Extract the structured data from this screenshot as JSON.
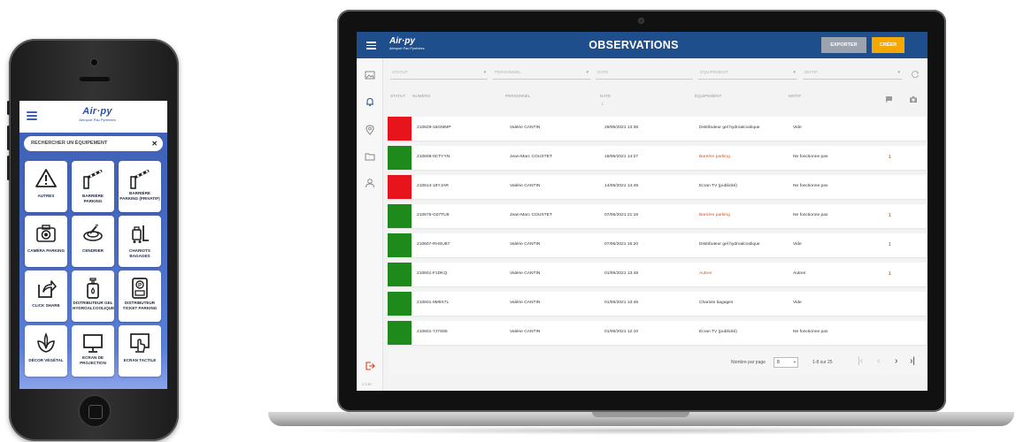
{
  "phone": {
    "logo_text": "Air·py",
    "logo_sub": "Aéroport Pau Pyrénées",
    "search_placeholder": "RECHERCHER UN ÉQUIPEMENT",
    "search_clear": "✕",
    "tiles": [
      {
        "label": "AUTRES",
        "icon": "warning-icon"
      },
      {
        "label": "BARRIÈRE PARKING",
        "icon": "barrier-icon"
      },
      {
        "label": "BARRIÈRE PARKING (PRIVATIF)",
        "icon": "barrier-private-icon"
      },
      {
        "label": "CAMÉRA PARKING",
        "icon": "camera-icon"
      },
      {
        "label": "CENDRIER",
        "icon": "ashtray-icon"
      },
      {
        "label": "CHARIOTS BAGAGES",
        "icon": "luggage-cart-icon"
      },
      {
        "label": "CLICK SHARE",
        "icon": "share-icon"
      },
      {
        "label": "DISTRIBUTEUR GEL HYDROALCOOLIQUE",
        "icon": "gel-dispenser-icon"
      },
      {
        "label": "DISTRIBUTEUR TICKET PARKING",
        "icon": "ticket-machine-icon"
      },
      {
        "label": "DÉCOR VÉGÉTAL",
        "icon": "plant-icon"
      },
      {
        "label": "ECRAN DE PROJECTION",
        "icon": "monitor-icon"
      },
      {
        "label": "ECRAN TACTILE",
        "icon": "touchscreen-icon"
      }
    ]
  },
  "app": {
    "logo_text": "Air·py",
    "logo_sub": "Aéroport Pau Pyrénées",
    "title": "OBSERVATIONS",
    "export_label": "EXPORTER",
    "create_label": "CRÉER",
    "version": "2.2.87",
    "nav_icons": [
      "image-icon",
      "bell-icon",
      "location-icon",
      "folder-icon",
      "user-icon"
    ],
    "logout_icon": "logout-icon",
    "filters": [
      "STATUT",
      "PERSONNEL",
      "DATE",
      "ÉQUIPEMENT",
      "MOTIF"
    ],
    "columns": [
      "STATUT",
      "NUMÉRO",
      "PERSONNEL",
      "DATE",
      "ÉQUIPEMENT",
      "MOTIF"
    ],
    "sort_arrow": "↓",
    "colors": {
      "red": "#e8141b",
      "green": "#1e8a1b",
      "header": "#1f4e8c",
      "accent": "#f5a800"
    },
    "rows": [
      {
        "status": "red",
        "numero": "210629-15GMMP",
        "personnel": "Valérie CANTIN",
        "date": "29/06/2021 13:38",
        "equipement": "Distributeur gel hydroalcoolique",
        "eq_orange": false,
        "motif": "Vide",
        "count": ""
      },
      {
        "status": "green",
        "numero": "210608-0CTYYN",
        "personnel": "Jean-Marc COUSTET",
        "date": "18/06/2021 14:27",
        "equipement": "Barrière parking",
        "eq_orange": true,
        "motif": "Ne fonctionne pas",
        "count": "1"
      },
      {
        "status": "red",
        "numero": "210614-18YJAR",
        "personnel": "Valérie CANTIN",
        "date": "14/06/2021 14:49",
        "equipement": "Ecran TV (publicité)",
        "eq_orange": false,
        "motif": "Ne fonctionne pas",
        "count": ""
      },
      {
        "status": "green",
        "numero": "210575-G07TU8",
        "personnel": "Jean-Marc COUSTET",
        "date": "07/06/2021 21:16",
        "equipement": "Barrière parking",
        "eq_orange": true,
        "motif": "Ne fonctionne pas",
        "count": "1"
      },
      {
        "status": "green",
        "numero": "210607-RHSU87",
        "personnel": "Valérie CANTIN",
        "date": "07/06/2021 15:20",
        "equipement": "Distributeur gel hydroalcoolique",
        "eq_orange": false,
        "motif": "Vide",
        "count": "1"
      },
      {
        "status": "green",
        "numero": "210601-F1DKQ",
        "personnel": "Valérie CANTIN",
        "date": "01/06/2021 13:48",
        "equipement": "Autres",
        "eq_orange": true,
        "motif": "Autres",
        "count": "1"
      },
      {
        "status": "green",
        "numero": "210601-9M9X7L",
        "personnel": "Valérie CANTIN",
        "date": "01/06/2021 13:46",
        "equipement": "Chariots bagages",
        "eq_orange": false,
        "motif": "Vide",
        "count": ""
      },
      {
        "status": "green",
        "numero": "210601-7J7S85",
        "personnel": "Valérie CANTIN",
        "date": "01/06/2021 12:10",
        "equipement": "Ecran TV (publicité)",
        "eq_orange": false,
        "motif": "Ne fonctionne pas",
        "count": ""
      }
    ],
    "pager": {
      "label": "Nombre par page",
      "per_page": "8",
      "range": "1-8 sur 25",
      "first": "|‹",
      "prev": "‹",
      "next": "›",
      "last": "›|"
    }
  }
}
